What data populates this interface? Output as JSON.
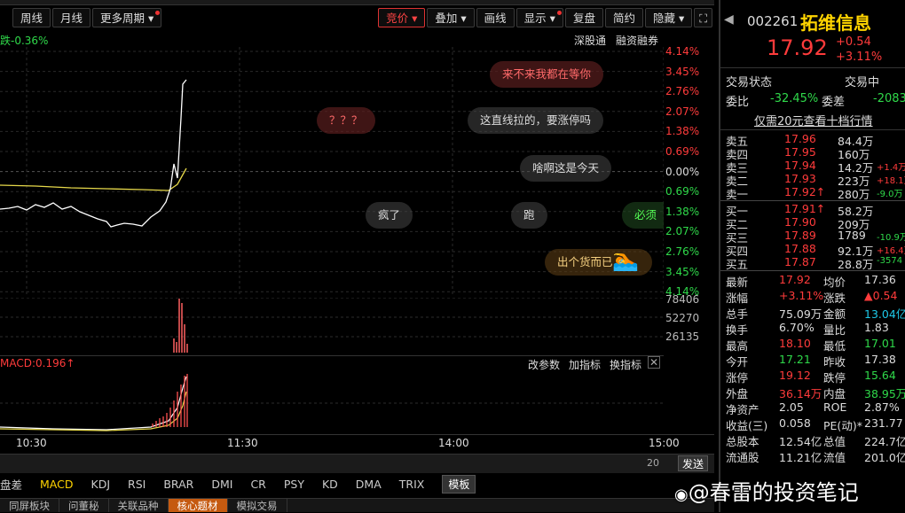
{
  "toolbar": {
    "left_buttons": [
      "周线",
      "月线",
      "更多周期"
    ],
    "right_buttons": [
      {
        "label": "竞价",
        "active": true
      },
      {
        "label": "叠加"
      },
      {
        "label": "画线"
      },
      {
        "label": "显示"
      },
      {
        "label": "复盘"
      },
      {
        "label": "简约"
      },
      {
        "label": "隐藏"
      }
    ]
  },
  "chart_header": {
    "change_text": "跌-0.36%",
    "links": [
      "深股通",
      "融资融券"
    ]
  },
  "chart_data": {
    "type": "line",
    "y_axis_right": [
      "4.14%",
      "3.45%",
      "2.76%",
      "2.07%",
      "1.38%",
      "0.69%",
      "0.00%",
      "0.69%",
      "1.38%",
      "2.07%",
      "2.76%",
      "3.45%",
      "4.14%"
    ],
    "ylim": [
      -4.14,
      4.14
    ],
    "x_ticks": [
      "10:30",
      "11:30",
      "14:00",
      "15:00"
    ],
    "series": [],
    "volume_ticks": [
      "78406",
      "52270",
      "26135"
    ],
    "macd_label": "MACD:0.196↑",
    "macd_actions": [
      "改参数",
      "加指标",
      "换指标"
    ]
  },
  "bubbles": [
    "来不来我都在等你",
    "？？？",
    "这直线拉的，要涨停吗",
    "啥啊这是今天",
    "疯了",
    "跑",
    "必须",
    "出个货而已"
  ],
  "comment": {
    "count": "20",
    "send": "发送"
  },
  "indicator_tabs": [
    "盘差",
    "MACD",
    "KDJ",
    "RSI",
    "BRAR",
    "DMI",
    "CR",
    "PSY",
    "KD",
    "DMA",
    "TRIX"
  ],
  "template_label": "模板",
  "bottom_tabs": [
    "同屏板块",
    "问董秘",
    "关联品种",
    "核心题材",
    "模拟交易"
  ],
  "watermark": "@春雷的投资笔记",
  "quote": {
    "code": "002261",
    "name": "拓维信息",
    "price": "17.92",
    "change": "+0.54",
    "change_pct": "+3.11%",
    "status_label": "交易状态",
    "status_value": "交易中",
    "weibi_label": "委比",
    "weibi": "-32.45%",
    "weicha_label": "委差",
    "weicha": "-2083",
    "promo": "仅需20元查看十档行情",
    "sells": [
      {
        "label": "卖五",
        "price": "17.96",
        "vol": "84.4万",
        "chg": ""
      },
      {
        "label": "卖四",
        "price": "17.95",
        "vol": "160万",
        "chg": ""
      },
      {
        "label": "卖三",
        "price": "17.94",
        "vol": "14.2万",
        "chg": "+1.4万"
      },
      {
        "label": "卖二",
        "price": "17.93",
        "vol": "223万",
        "chg": "+18.1万"
      },
      {
        "label": "卖一",
        "price": "17.92↑",
        "vol": "280万",
        "chg": "-9.0万"
      }
    ],
    "buys": [
      {
        "label": "买一",
        "price": "17.91↑",
        "vol": "58.2万",
        "chg": ""
      },
      {
        "label": "买二",
        "price": "17.90",
        "vol": "209万",
        "chg": ""
      },
      {
        "label": "买三",
        "price": "17.89",
        "vol": "1789",
        "chg": "-10.9万"
      },
      {
        "label": "买四",
        "price": "17.88",
        "vol": "92.1万",
        "chg": "+16.4万"
      },
      {
        "label": "买五",
        "price": "17.87",
        "vol": "28.8万",
        "chg": "-3574"
      }
    ],
    "stats": [
      [
        "最新",
        "17.92",
        "均价",
        "17.36"
      ],
      [
        "涨幅",
        "+3.11%",
        "涨跌",
        "▲0.54"
      ],
      [
        "总手",
        "75.09万",
        "金额",
        "13.04亿"
      ],
      [
        "换手",
        "6.70%",
        "量比",
        "1.83"
      ],
      [
        "最高",
        "18.10",
        "最低",
        "17.01"
      ],
      [
        "今开",
        "17.21",
        "昨收",
        "17.38"
      ],
      [
        "涨停",
        "19.12",
        "跌停",
        "15.64"
      ],
      [
        "外盘",
        "36.14万",
        "内盘",
        "38.95万"
      ],
      [
        "净资产",
        "2.05",
        "ROE",
        "2.87%"
      ],
      [
        "收益(三)",
        "0.058",
        "PE(动)*",
        "231.77"
      ],
      [
        "总股本",
        "12.54亿",
        "总值",
        "224.7亿"
      ],
      [
        "流通股",
        "11.21亿",
        "流值",
        "201.0亿"
      ]
    ]
  }
}
